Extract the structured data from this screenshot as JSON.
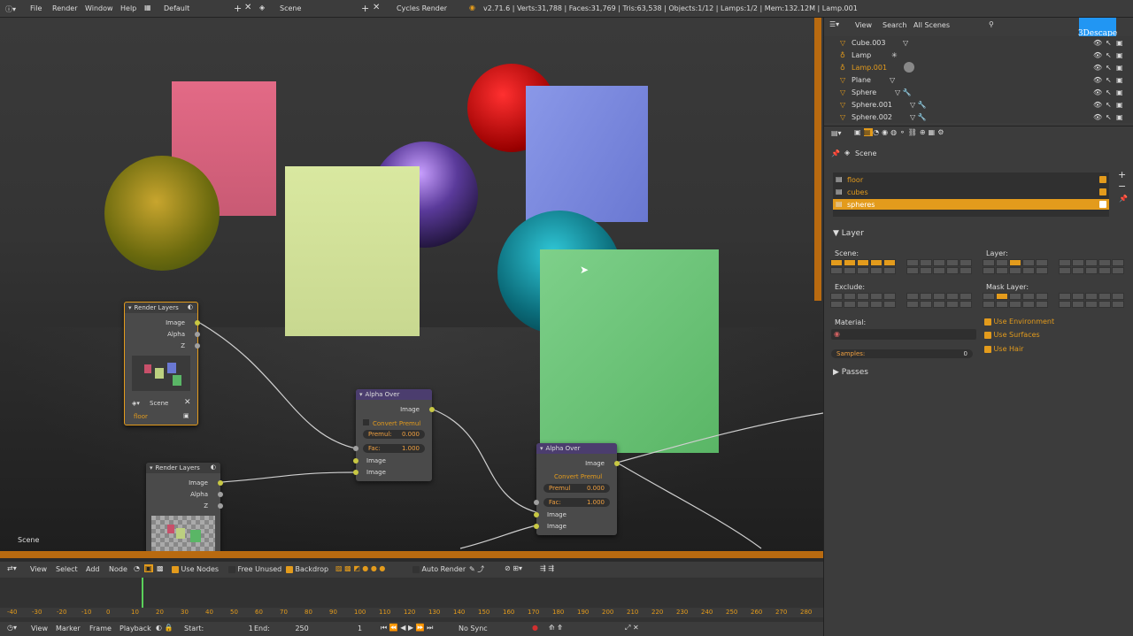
{
  "topbar": {
    "menus": [
      "File",
      "Render",
      "Window",
      "Help"
    ],
    "layout": "Default",
    "scene": "Scene",
    "engine": "Cycles Render",
    "stats": "v2.71.6 | Verts:31,788 | Faces:31,769 | Tris:63,538 | Objects:1/12 | Lamps:1/2 | Mem:132.12M | Lamp.001"
  },
  "viewport": {
    "scene_label": "Scene"
  },
  "nodes": {
    "render_layers_1": {
      "title": "Render Layers",
      "outputs": [
        "Image",
        "Alpha",
        "Z"
      ],
      "scene": "Scene",
      "layer": "floor"
    },
    "render_layers_2": {
      "title": "Render Layers",
      "outputs": [
        "Image",
        "Alpha",
        "Z"
      ]
    },
    "alpha_over_1": {
      "title": "Alpha Over",
      "output": "Image",
      "convert": "Convert Premul",
      "premul_label": "Premul:",
      "premul_value": "0.000",
      "fac_label": "Fac:",
      "fac_value": "1.000",
      "inputs": [
        "Image",
        "Image"
      ]
    },
    "alpha_over_2": {
      "title": "Alpha Over",
      "output": "Image",
      "convert": "Convert Premul",
      "premul_label": "Premul",
      "premul_value": "0.000",
      "fac_label": "Fac:",
      "fac_value": "1.000",
      "inputs": [
        "Image",
        "Image"
      ]
    }
  },
  "node_header": {
    "items": [
      "View",
      "Select",
      "Add",
      "Node"
    ],
    "use_nodes": "Use Nodes",
    "free_unused": "Free Unused",
    "backdrop": "Backdrop",
    "auto_render": "Auto Render"
  },
  "timeline": {
    "ticks": [
      "-40",
      "-30",
      "-20",
      "-10",
      "0",
      "10",
      "20",
      "30",
      "40",
      "50",
      "60",
      "70",
      "80",
      "90",
      "100",
      "110",
      "120",
      "130",
      "140",
      "150",
      "160",
      "170",
      "180",
      "190",
      "200",
      "210",
      "220",
      "230",
      "240",
      "250",
      "260",
      "270",
      "280"
    ]
  },
  "timeline_header": {
    "items": [
      "View",
      "Marker",
      "Frame",
      "Playback"
    ],
    "start_label": "Start:",
    "start": "1",
    "end_label": "End:",
    "end": "250",
    "current": "1",
    "sync": "No Sync"
  },
  "outliner": {
    "menus": [
      "View",
      "Search",
      "All Scenes"
    ],
    "rows": [
      "Cube.003",
      "Lamp",
      "Lamp.001",
      "Plane",
      "Sphere",
      "Sphere.001",
      "Sphere.002"
    ],
    "logo": "3Descape"
  },
  "properties": {
    "scene": "Scene",
    "layers": [
      "floor",
      "cubes",
      "spheres"
    ],
    "layer_panel": "Layer",
    "scene_label": "Scene:",
    "layer_label": "Layer:",
    "exclude_label": "Exclude:",
    "mask_label": "Mask Layer:",
    "material_label": "Material:",
    "use_environment": "Use Environment",
    "use_surfaces": "Use Surfaces",
    "use_hair": "Use Hair",
    "samples_label": "Samples:",
    "samples_value": "0",
    "passes": "Passes"
  },
  "colors": {
    "accent": "#e39b1c",
    "node_alpha": "#4b3d6e",
    "node_render": "#3d3d3d"
  }
}
